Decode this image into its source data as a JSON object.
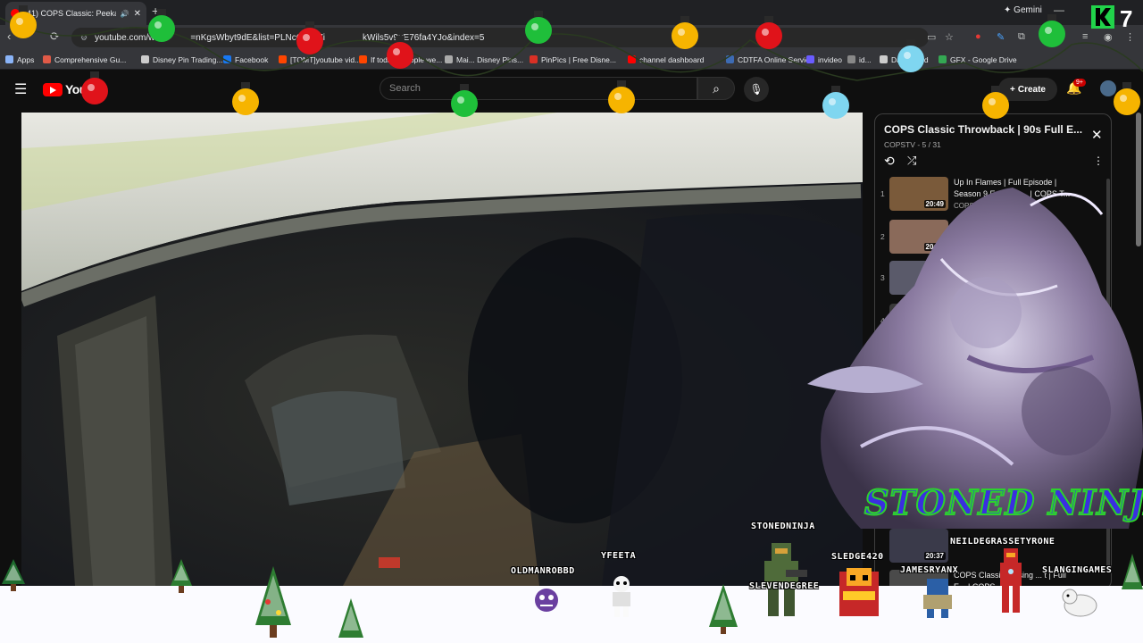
{
  "browser": {
    "tab_title": "(41) COPS Classic: Peekabo",
    "url": "youtube.com/w",
    "url_mid": "=nKgsWbyt9dE&list=PLNcQdq67i",
    "url_tail": "kWils5v9uE76fa4YJo&index=5",
    "new_tab": "+",
    "gemini": "Gemini"
  },
  "bookmarks": [
    {
      "label": "Apps",
      "color": "#8ab4f8"
    },
    {
      "label": "Comprehensive Gu...",
      "color": "#e05a47"
    },
    {
      "label": "Disney Pin Trading...",
      "color": "#cccccc"
    },
    {
      "label": "Facebook",
      "color": "#1877f2"
    },
    {
      "label": "[TOMT]youtube vid...",
      "color": "#ff4500"
    },
    {
      "label": "If todays people we...",
      "color": "#ff4500"
    },
    {
      "label": "Mai... Disney Pins...",
      "color": "#aaaaaa"
    },
    {
      "label": "PinPics | Free Disne...",
      "color": "#d93025"
    },
    {
      "label": "channel dashboard",
      "color": "#ff0000"
    },
    {
      "label": "CDTFA Online Servic...",
      "color": "#3d6bb3"
    },
    {
      "label": "invideo",
      "color": "#6a5cff"
    },
    {
      "label": "id...",
      "color": "#888888"
    },
    {
      "label": "Dashboard",
      "color": "#cccccc"
    },
    {
      "label": "GFX - Google Drive",
      "color": "#34a853"
    }
  ],
  "youtube": {
    "logo_text": "YouT",
    "search_placeholder": "Search",
    "create_label": "Create",
    "notif_count": "9+"
  },
  "playlist": {
    "title": "COPS Classic Throwback | 90s Full E...",
    "channel": "COPSTV",
    "position": "5 / 31",
    "items": [
      {
        "index": "1",
        "title": "Up In Flames | Full Episode | Season 9 Episode ... | COPS T...",
        "duration": "20:49",
        "channel": "COPS"
      },
      {
        "index": "2",
        "title": "",
        "duration": "20:13",
        "channel": ""
      },
      {
        "index": "3",
        "title": "",
        "duration": "20:49",
        "channel": ""
      },
      {
        "index": "4",
        "title": "",
        "duration": "",
        "channel": ""
      },
      {
        "index": "",
        "title": "",
        "duration": "20:37",
        "channel": ""
      },
      {
        "index": "",
        "title": "COPS Classi... Losing ... t | Full E... | COPS ...",
        "duration": "20:42",
        "channel": "COPSTV"
      }
    ]
  },
  "overlay": {
    "banner": "STONED NINJA",
    "k7": "7",
    "usernames": [
      "OLDMANROBBD",
      "YFEETA",
      "STONEDNINJA",
      "SLEVENDEGREE",
      "SLEDGE420",
      "NEILDEGRASSETYRONE",
      "JAMESRYANX",
      "SLANGINGAMES"
    ]
  },
  "colors": {
    "yt_red": "#ff0000",
    "banner_fill": "#3a2fe0",
    "banner_stroke": "#2dd12d",
    "k7_green": "#21d24a"
  }
}
